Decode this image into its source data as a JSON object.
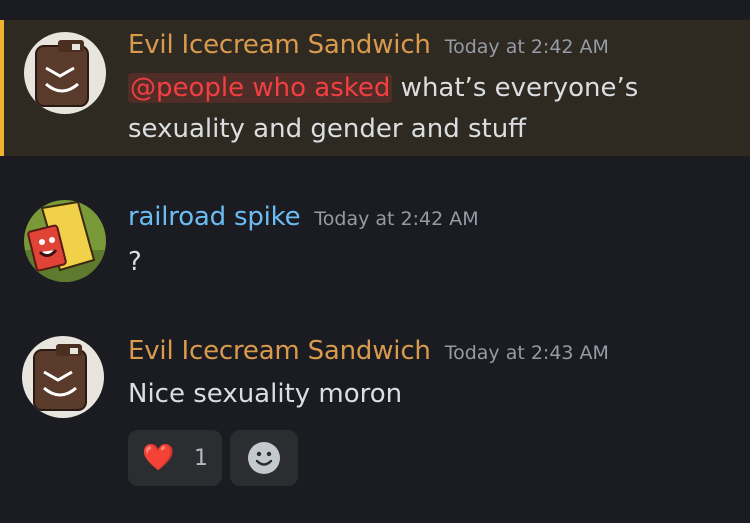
{
  "messages": [
    {
      "username": "Evil Icecream Sandwich",
      "username_color": "#d99a4e",
      "timestamp": "Today at 2:42 AM",
      "mention": "@people who asked",
      "text": " what’s everyone’s sexuality and gender and stuff",
      "highlighted": true,
      "avatar_icon": "ice-cream-sandwich-avatar-icon"
    },
    {
      "username": "railroad spike",
      "username_color": "#6cbcf4",
      "timestamp": "Today at 2:42 AM",
      "text": "?",
      "avatar_icon": "railroad-spike-avatar-icon"
    },
    {
      "username": "Evil Icecream Sandwich",
      "username_color": "#d99a4e",
      "timestamp": "Today at 2:43 AM",
      "text": "Nice sexuality moron",
      "avatar_icon": "ice-cream-sandwich-avatar-icon",
      "reactions": [
        {
          "emoji": "❤️",
          "icon": "heart-icon",
          "count": "1"
        },
        {
          "icon": "add-reaction-smiley-icon"
        }
      ]
    }
  ],
  "colors": {
    "background": "#1b1c21",
    "highlight_bg": "#2e2a22",
    "highlight_bar": "#f0b232",
    "mention": "#f23f43",
    "text": "#dbdee1",
    "timestamp": "#949ba4"
  }
}
